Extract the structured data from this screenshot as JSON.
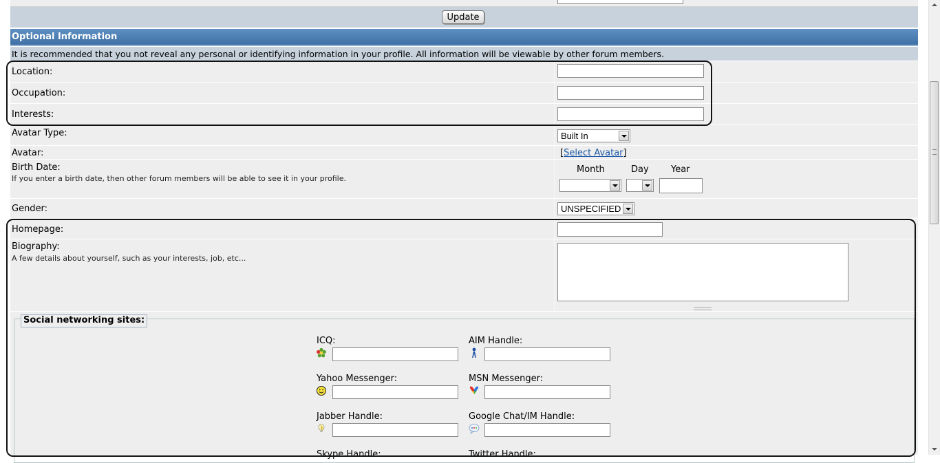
{
  "update_button": "Update",
  "section_title": "Optional Information",
  "notice": "It is recommended that you not reveal any personal or identifying information in your profile. All information will be viewable by other forum members.",
  "fields": {
    "location": "Location:",
    "occupation": "Occupation:",
    "interests": "Interests:",
    "avatar_type": "Avatar Type:",
    "avatar_type_value": "Built In",
    "avatar": "Avatar:",
    "avatar_link_open": "[",
    "avatar_link": "Select Avatar",
    "avatar_link_close": "]",
    "birth_date": "Birth Date:",
    "birth_date_desc": "If you enter a birth date, then other forum members will be able to see it in your profile.",
    "month": "Month",
    "day": "Day",
    "year": "Year",
    "gender": "Gender:",
    "gender_value": "UNSPECIFIED",
    "homepage": "Homepage:",
    "biography": "Biography:",
    "biography_desc": "A few details about yourself, such as your interests, job, etc..."
  },
  "social": {
    "legend": "Social networking sites:",
    "icq": "ICQ:",
    "aim": "AIM Handle:",
    "yahoo": "Yahoo Messenger:",
    "msn": "MSN Messenger:",
    "jabber": "Jabber Handle:",
    "google": "Google Chat/IM Handle:",
    "skype": "Skype Handle:",
    "twitter": "Twitter Handle:"
  },
  "colors": {
    "header_blue": "#4a7db3",
    "row_bg": "#eeeeee",
    "notice_bg": "#c7d2dc",
    "link": "#1d5aa7"
  }
}
